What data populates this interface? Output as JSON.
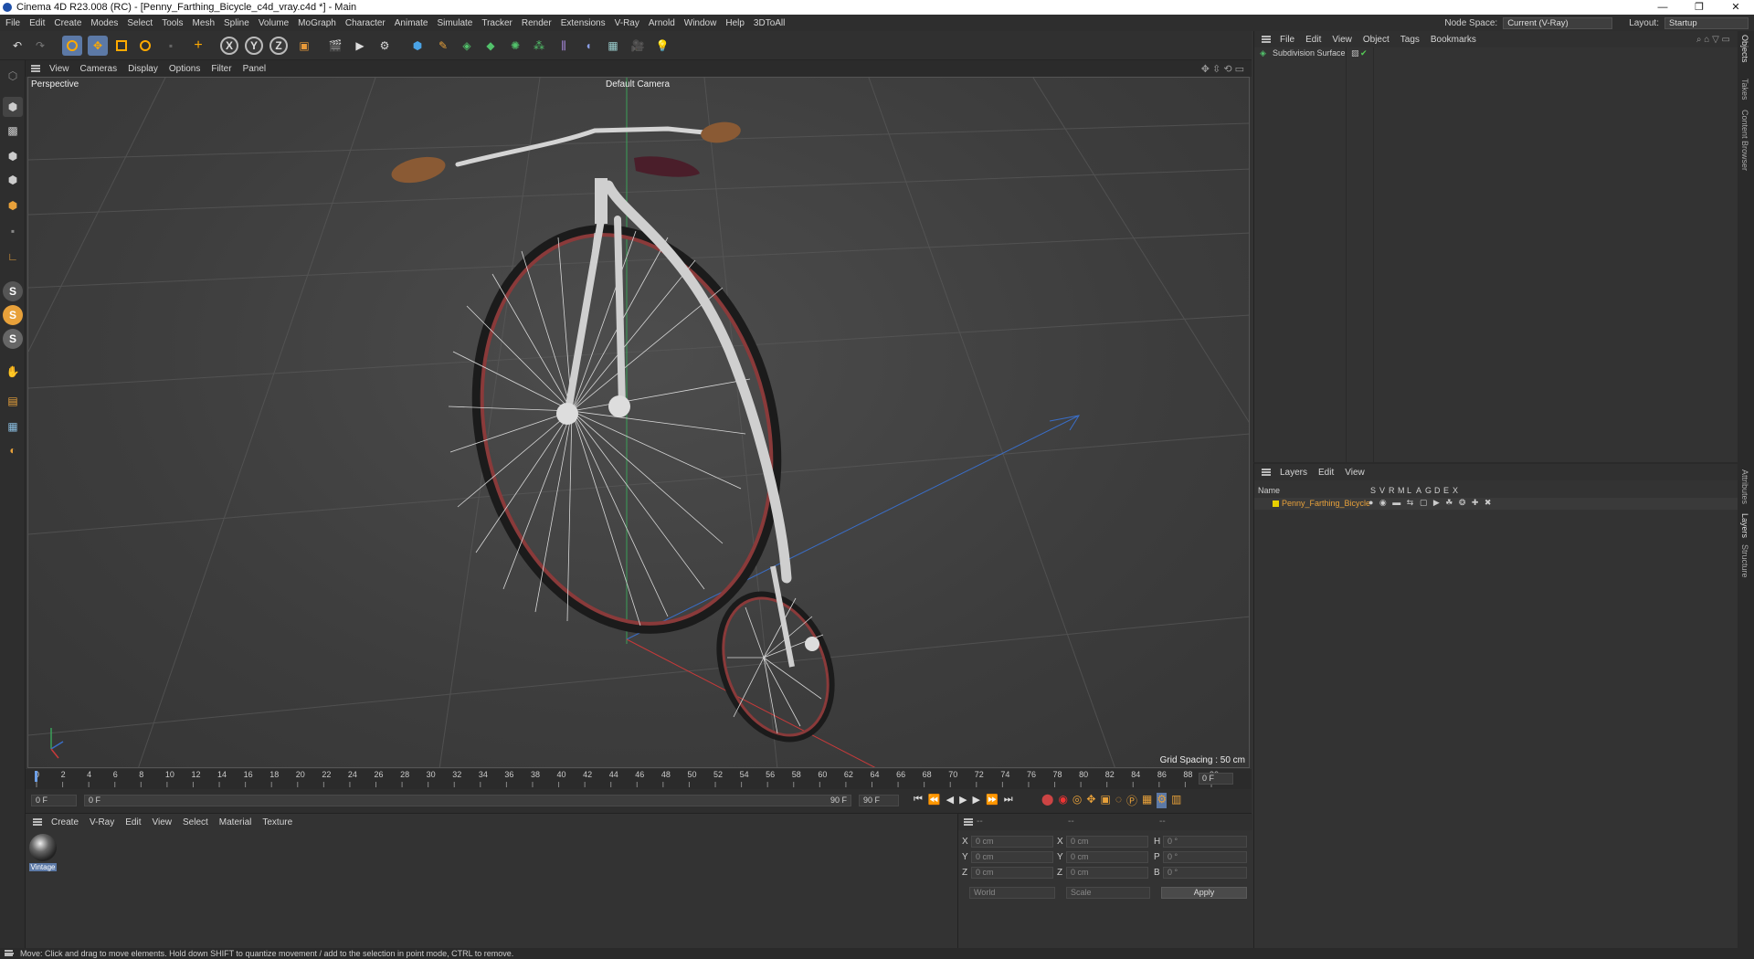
{
  "window": {
    "title": "Cinema 4D R23.008 (RC) - [Penny_Farthing_Bicycle_c4d_vray.c4d *] - Main",
    "controls": [
      "—",
      "❐",
      "✕"
    ]
  },
  "menubar": {
    "items": [
      "File",
      "Edit",
      "Create",
      "Modes",
      "Select",
      "Tools",
      "Mesh",
      "Spline",
      "Volume",
      "MoGraph",
      "Character",
      "Animate",
      "Simulate",
      "Tracker",
      "Render",
      "Extensions",
      "V-Ray",
      "Arnold",
      "Window",
      "Help",
      "3DToAll"
    ],
    "node_space_label": "Node Space:",
    "node_space_value": "Current (V-Ray)",
    "layout_label": "Layout:",
    "layout_value": "Startup"
  },
  "viewport": {
    "menu": [
      "View",
      "Cameras",
      "Display",
      "Options",
      "Filter",
      "Panel"
    ],
    "projection": "Perspective",
    "camera": "Default Camera",
    "grid_spacing": "Grid Spacing : 50 cm"
  },
  "timeline": {
    "ticks": [
      "0",
      "2",
      "4",
      "6",
      "8",
      "10",
      "12",
      "14",
      "16",
      "18",
      "20",
      "22",
      "24",
      "26",
      "28",
      "30",
      "32",
      "34",
      "36",
      "38",
      "40",
      "42",
      "44",
      "46",
      "48",
      "50",
      "52",
      "54",
      "56",
      "58",
      "60",
      "62",
      "64",
      "66",
      "68",
      "70",
      "72",
      "74",
      "76",
      "78",
      "80",
      "82",
      "84",
      "86",
      "88",
      "90"
    ],
    "current_frame": "0 F"
  },
  "transport": {
    "start": "0 F",
    "range_start": "0 F",
    "range_end": "90 F",
    "end": "90 F"
  },
  "materials": {
    "menu": [
      "Create",
      "V-Ray",
      "Edit",
      "View",
      "Select",
      "Material",
      "Texture"
    ],
    "items": [
      {
        "name": "Vintage"
      }
    ]
  },
  "coords": {
    "pos_labels": [
      "X",
      "Y",
      "Z"
    ],
    "size_labels": [
      "X",
      "Y",
      "Z"
    ],
    "rot_labels": [
      "H",
      "P",
      "B"
    ],
    "pos_values": [
      "0 cm",
      "0 cm",
      "0 cm"
    ],
    "size_values": [
      "0 cm",
      "0 cm",
      "0 cm"
    ],
    "rot_values": [
      "0 °",
      "0 °",
      "0 °"
    ],
    "header_dashes": [
      "--",
      "--",
      "--"
    ],
    "space": "World",
    "mode": "Scale",
    "apply": "Apply"
  },
  "objects": {
    "menu": [
      "File",
      "Edit",
      "View",
      "Object",
      "Tags",
      "Bookmarks"
    ],
    "items": [
      {
        "name": "Subdivision Surface"
      }
    ]
  },
  "layers": {
    "menu": [
      "Layers",
      "Edit",
      "View"
    ],
    "col_name": "Name",
    "col_flags": [
      "S",
      "V",
      "R",
      "M",
      "L",
      "A",
      "G",
      "D",
      "E",
      "X"
    ],
    "items": [
      {
        "name": "Penny_Farthing_Bicycle",
        "color": "#e8d000"
      }
    ]
  },
  "right_tabs": [
    "Objects",
    "Takes",
    "Content Browser",
    "Attributes",
    "Layers",
    "Structure"
  ],
  "status": "Move: Click and drag to move elements. Hold down SHIFT to quantize movement / add to the selection in point mode, CTRL to remove.",
  "colors": {
    "accent": "#5c79a6",
    "wheel_rim": "#8a3a3a",
    "frame": "#cfcfcf",
    "grip": "#8a5a34",
    "saddle": "#4a1e2a"
  }
}
